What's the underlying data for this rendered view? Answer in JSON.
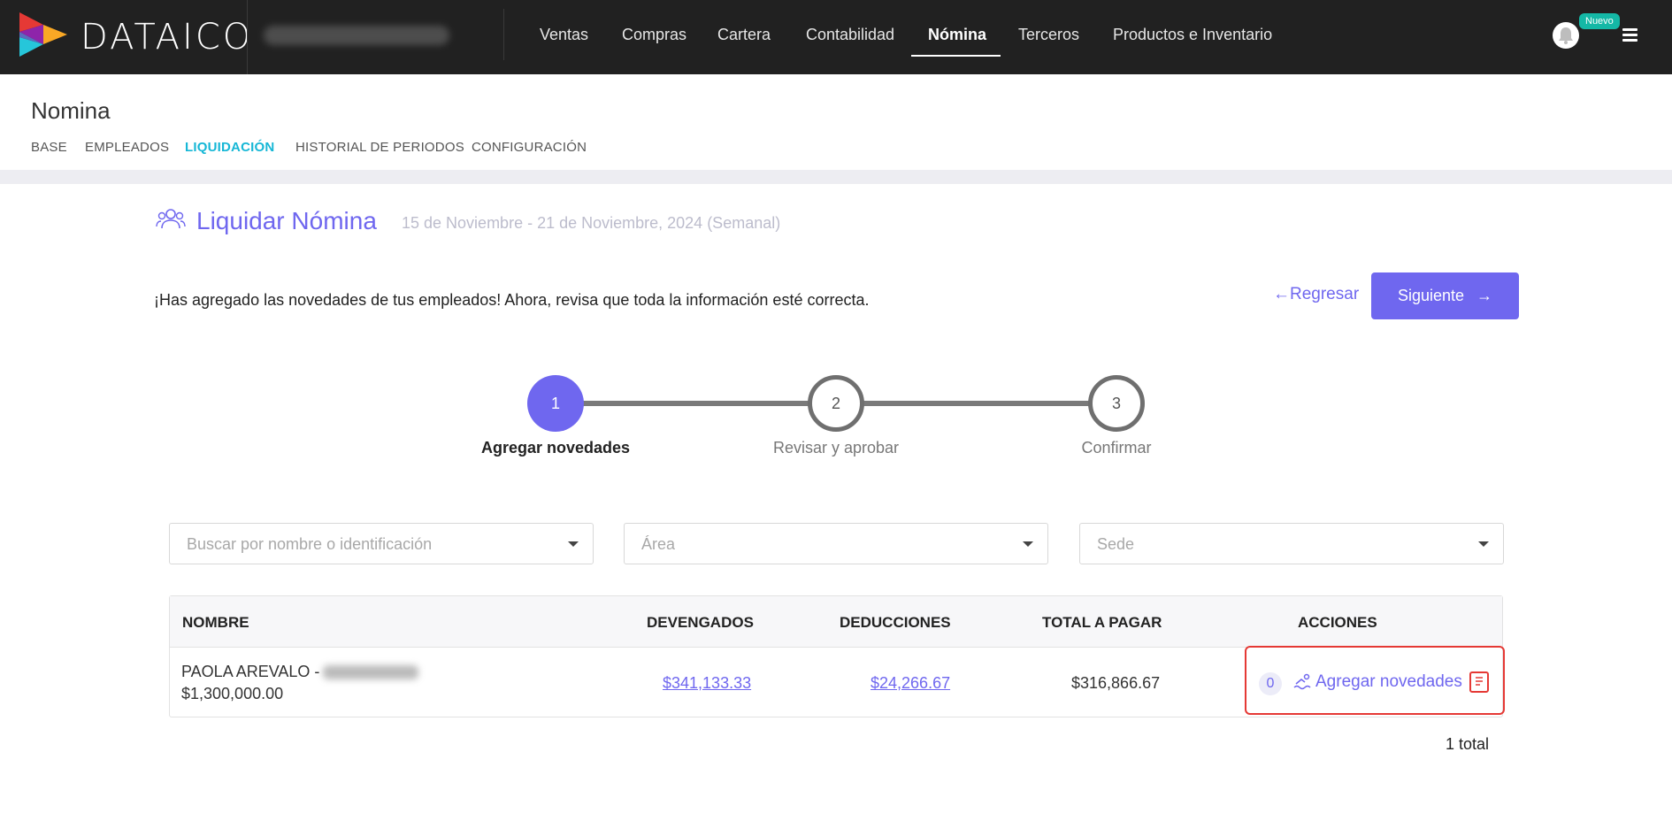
{
  "brand": {
    "name": "DATAICO"
  },
  "nav": {
    "items": [
      "Ventas",
      "Compras",
      "Cartera",
      "Contabilidad",
      "Nómina",
      "Terceros",
      "Productos e Inventario"
    ],
    "active": "Nómina",
    "badge": "Nuevo"
  },
  "page": {
    "title": "Nomina",
    "subnav": [
      "BASE",
      "EMPLEADOS",
      "LIQUIDACIÓN",
      "HISTORIAL DE PERIODOS",
      "CONFIGURACIÓN"
    ],
    "subnav_active": "LIQUIDACIÓN"
  },
  "liquidar": {
    "title": "Liquidar Nómina",
    "period": "15 de Noviembre - 21 de Noviembre, 2024 (Semanal)",
    "info": "¡Has agregado las novedades de tus empleados! Ahora, revisa que toda la información esté correcta.",
    "back_label": "Regresar",
    "next_label": "Siguiente"
  },
  "stepper": {
    "steps": [
      {
        "number": "1",
        "label": "Agregar novedades",
        "active": true
      },
      {
        "number": "2",
        "label": "Revisar y aprobar",
        "active": false
      },
      {
        "number": "3",
        "label": "Confirmar",
        "active": false
      }
    ]
  },
  "filters": {
    "search_placeholder": "Buscar por nombre o identificación",
    "area_placeholder": "Área",
    "sede_placeholder": "Sede"
  },
  "table": {
    "headers": {
      "nombre": "NOMBRE",
      "devengados": "DEVENGADOS",
      "deducciones": "DEDUCCIONES",
      "total": "TOTAL A PAGAR",
      "acciones": "ACCIONES"
    },
    "rows": [
      {
        "name": "PAOLA AREVALO -",
        "salary": "$1,300,000.00",
        "devengados": "$341,133.33",
        "deducciones": "$24,266.67",
        "total": "$316,866.67",
        "novedades_count": "0",
        "action_label": "Agregar novedades"
      }
    ]
  },
  "footer": {
    "total_label": "1  total"
  },
  "colors": {
    "accent": "#6f67ef",
    "topbar": "#212121",
    "active_subnav": "#16b7d6",
    "badge": "#14b8a6",
    "highlight": "#e53935"
  }
}
